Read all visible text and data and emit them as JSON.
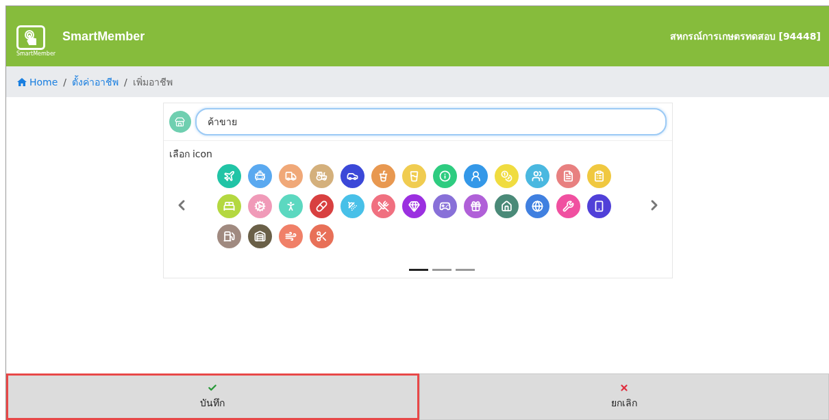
{
  "header": {
    "brand": "SmartMember",
    "logo_caption": "SmartMember",
    "organization": "สหกรณ์การเกษตรทดสอบ [94448]"
  },
  "breadcrumb": [
    {
      "label": "Home",
      "kind": "home"
    },
    {
      "label": "ตั้งค่าอาชีพ",
      "kind": "link"
    },
    {
      "label": "เพิ่มอาชีพ",
      "kind": "current"
    }
  ],
  "separator": "/",
  "form": {
    "selected_icon": {
      "kind": "store",
      "color": "#6fcfb0"
    },
    "name_field": {
      "value": "ค้าขาย"
    },
    "icon_label": "เลือก icon"
  },
  "icons": [
    {
      "kind": "plane",
      "color": "#21c4a6"
    },
    {
      "kind": "taxi",
      "color": "#5aa9f0"
    },
    {
      "kind": "truck",
      "color": "#f0a878"
    },
    {
      "kind": "tractor",
      "color": "#d4b07c"
    },
    {
      "kind": "car",
      "color": "#3b48d8"
    },
    {
      "kind": "cup",
      "color": "#e89850"
    },
    {
      "kind": "glass",
      "color": "#f0cc50"
    },
    {
      "kind": "info",
      "color": "#2ecc80"
    },
    {
      "kind": "person",
      "color": "#3498e8"
    },
    {
      "kind": "coins",
      "color": "#f0dc40"
    },
    {
      "kind": "group",
      "color": "#4ab8e0"
    },
    {
      "kind": "document",
      "color": "#e88080"
    },
    {
      "kind": "clipboard",
      "color": "#f0c840"
    },
    {
      "kind": "bed",
      "color": "#b4d840"
    },
    {
      "kind": "gears",
      "color": "#f09ab8"
    },
    {
      "kind": "hiker",
      "color": "#5cd8c0"
    },
    {
      "kind": "pill",
      "color": "#d84040"
    },
    {
      "kind": "faucet",
      "color": "#48c0e8"
    },
    {
      "kind": "utensils",
      "color": "#f07080"
    },
    {
      "kind": "gem",
      "color": "#9b30e0"
    },
    {
      "kind": "gamepad",
      "color": "#8870d8"
    },
    {
      "kind": "gift",
      "color": "#b060d8"
    },
    {
      "kind": "house",
      "color": "#4a8a78"
    },
    {
      "kind": "globe",
      "color": "#4080e0"
    },
    {
      "kind": "tools",
      "color": "#f050a0"
    },
    {
      "kind": "phone",
      "color": "#5040d8"
    },
    {
      "kind": "fuel",
      "color": "#a08a80"
    },
    {
      "kind": "garage",
      "color": "#6a6048"
    },
    {
      "kind": "wind",
      "color": "#f08068"
    },
    {
      "kind": "scissors",
      "color": "#e87058"
    }
  ],
  "carousel_indicators": [
    {
      "selected": true
    },
    {
      "selected": false
    },
    {
      "selected": false
    }
  ],
  "footer_buttons": [
    {
      "kind": "save",
      "label": "บันทึก",
      "highlighted": true
    },
    {
      "kind": "cancel",
      "label": "ยกเลิก",
      "highlighted": false
    }
  ]
}
